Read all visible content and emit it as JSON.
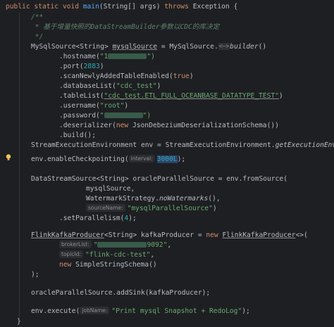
{
  "lines": {
    "l1": {
      "mods": "public static void ",
      "method": "main",
      "sig": "(String[] args) ",
      "throws_kw": "throws",
      "exc": " Exception {"
    },
    "l2": {
      "text": "/**"
    },
    "l3": {
      "text": " * 基于增量快照的DataStreamBuilder参数以CDC的库决定"
    },
    "l4": {
      "text": " */"
    },
    "l5": {
      "type": "MySqlSource<String> ",
      "var": "mysqlSource",
      "rest": " = MySqlSource.",
      "fold": "<~>",
      "builder": "builder",
      "end": "()"
    },
    "l6": {
      "pre": ".hostname(",
      "str": "\"1",
      "post": "\")"
    },
    "l7": {
      "pre": ".port(",
      "num": "2883",
      "post": ")"
    },
    "l8": {
      "pre": ".scanNewlyAddedTableEnabled(",
      "kw": "true",
      "post": ")"
    },
    "l9": {
      "pre": ".databaseList(",
      "str": "\"cdc_test\"",
      "post": ")"
    },
    "l10": {
      "pre": ".tableList(",
      "str": "\"cdc_test.ETL_FULL_OCEANBASE_DATATYPE_TEST\"",
      "post": ")"
    },
    "l11": {
      "pre": ".username(",
      "str": "\"root\"",
      "post": ")"
    },
    "l12": {
      "pre": ".password(",
      "str": "\"",
      "post": "\")"
    },
    "l13": {
      "pre": ".deserializer(",
      "kw": "new",
      "post": " JsonDebeziumDeserializationSchema())"
    },
    "l14": {
      "text": ".build();"
    },
    "l15": {
      "pre": "StreamExecutionEnvironment env = StreamExecutionEnvironment.",
      "call": "getExecutionEnvironment",
      "post": "();"
    },
    "l16": {
      "pre": "env.enableCheckpointing(",
      "hint": "interval:",
      "num": "3000L",
      "post": ");"
    },
    "l17": {
      "text": "DataStreamSource<String> oracleParallelSource = env.fromSource("
    },
    "l18": {
      "text": "mysqlSource,"
    },
    "l19": {
      "pre": "WatermarkStrategy.",
      "call": "noWatermarks",
      "post": "(),"
    },
    "l20": {
      "hint": "sourceName:",
      "str": "\"mysqlParallelSource\"",
      "post": ")"
    },
    "l21": {
      "pre": ".setParallelism(",
      "num": "4",
      "post": ");"
    },
    "l22": {
      "cls": "FlinkKafkaProducer",
      "gen": "<String> kafkaProducer = ",
      "kw": "new",
      "cls2": "FlinkKafkaProducer",
      "post": "<>("
    },
    "l23": {
      "hint": "brokerList:",
      "str_a": "\"",
      "str_b": "9092\"",
      "post": ","
    },
    "l24": {
      "hint": "topicId:",
      "str": "\"flink-cdc-test\"",
      "post": ","
    },
    "l25": {
      "kw": "new",
      "post": " SimpleStringSchema()"
    },
    "l26": {
      "text": ");"
    },
    "l27": {
      "text": "oracleParallelSource.addSink(kafkaProducer);"
    },
    "l28": {
      "pre": "env.execute(",
      "hint": "jobName:",
      "str": "\"Print mysql Snapshot + RedoLog\"",
      "post": ");"
    },
    "l29": {
      "text": "}"
    }
  },
  "icons": {
    "bulb": "lightbulb-icon",
    "fold": "fold-ellipsis-icon"
  },
  "colors": {
    "background": "#1e1f22",
    "keyword": "#cf8e6d",
    "method": "#56a8f5",
    "string": "#6aab73",
    "number": "#2aacb8",
    "comment": "#5f826b",
    "bulb": "#f2c55c"
  }
}
